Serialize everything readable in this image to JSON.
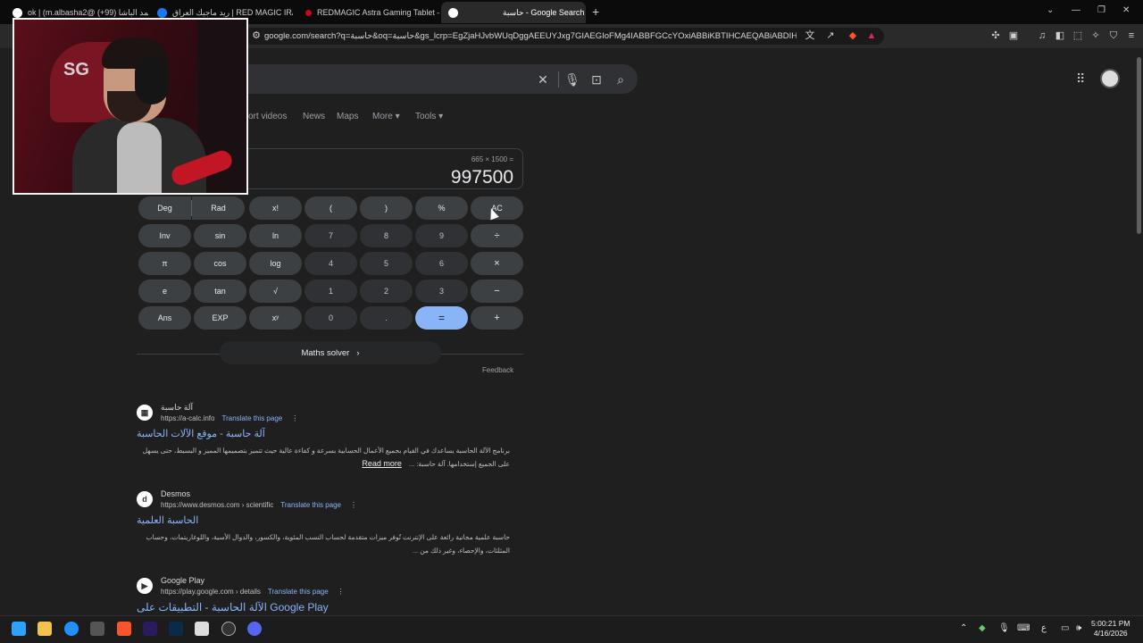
{
  "browser": {
    "tabs": [
      {
        "title": "ok | (m.albasha2@ محمد الباشا (99+)",
        "favicon_color": "#ffffff"
      },
      {
        "title": "ريد ماجيك العراق | RED MAGIC IRAQ | Facebook",
        "favicon_color": "#1877f2"
      },
      {
        "title": "REDMAGIC Astra Gaming Tablet – Sn",
        "favicon_color": "#d0021b"
      },
      {
        "title": "حاسبة - Google Search",
        "favicon_color": "#ffffff",
        "active": true
      }
    ],
    "new_tab": "+",
    "url": "google.com/search?q=حاسبة&oq=حاسبة&gs_lcrp=EgZjaHJvbWUqDggAEEUYJxg7GIAEGIoFMg4IABBFGCcYOxiABBiKBTIHCAEQABiABDIHCAIQAB..."
  },
  "search": {
    "nav_tabs": [
      "ort videos",
      "News",
      "Maps",
      "More",
      "Tools"
    ]
  },
  "calculator": {
    "expression": "665 × 1500 =",
    "result": "997500",
    "keys": {
      "deg": "Deg",
      "rad": "Rad",
      "fact": "x!",
      "lparen": "(",
      "rparen": ")",
      "percent": "%",
      "ac": "AC",
      "inv": "Inv",
      "sin": "sin",
      "ln": "ln",
      "n7": "7",
      "n8": "8",
      "n9": "9",
      "div": "÷",
      "pi": "π",
      "cos": "cos",
      "log": "log",
      "n4": "4",
      "n5": "5",
      "n6": "6",
      "mul": "×",
      "e": "e",
      "tan": "tan",
      "sqrt": "√",
      "n1": "1",
      "n2": "2",
      "n3": "3",
      "sub": "−",
      "ans": "Ans",
      "exp": "EXP",
      "pow": "xʸ",
      "n0": "0",
      "dot": ".",
      "eq": "=",
      "add": "+"
    },
    "solver": "Maths solver",
    "feedback": "Feedback"
  },
  "results": [
    {
      "site": "آلة حاسبة",
      "url": "https://a-calc.info",
      "translate": "Translate this page",
      "title": "آلة حاسبة - موقع الآلات الحاسبة",
      "snippet": "برنامج الآلة الحاسبة يساعدك في القيام بجميع الأعمال الحسابية بسرعة و كفاءة عالية حيث تتميز بتصميمها المميز و البسيط، حتى يسهل على الجميع إستخدامها. آلة حاسبة: ...",
      "read_more": "Read more"
    },
    {
      "site": "Desmos",
      "url": "https://www.desmos.com › scientific",
      "translate": "Translate this page",
      "title": "الحاسبة العلمية",
      "snippet": "حاسبة علمية مجانية رائعة على الإنترنت تُوفر ميزات متقدمة لحساب النسب المئوية، والكسور، والدوال الأسية، واللوغاريتمات، وحساب المثلثات، والإحصاء، وغير ذلك من ..."
    },
    {
      "site": "Google Play",
      "url": "https://play.google.com › details",
      "translate": "Translate this page",
      "title": "الآلة الحاسبة - التطبيقات على Google Play"
    }
  ],
  "taskbar": {
    "tray_lang": "ع",
    "time": "5:00:21 PM",
    "date": "4/16/2026"
  },
  "colors": {
    "background": "#1f1f1f",
    "link": "#8ab4f8",
    "equals_key": "#8ab4f8"
  }
}
